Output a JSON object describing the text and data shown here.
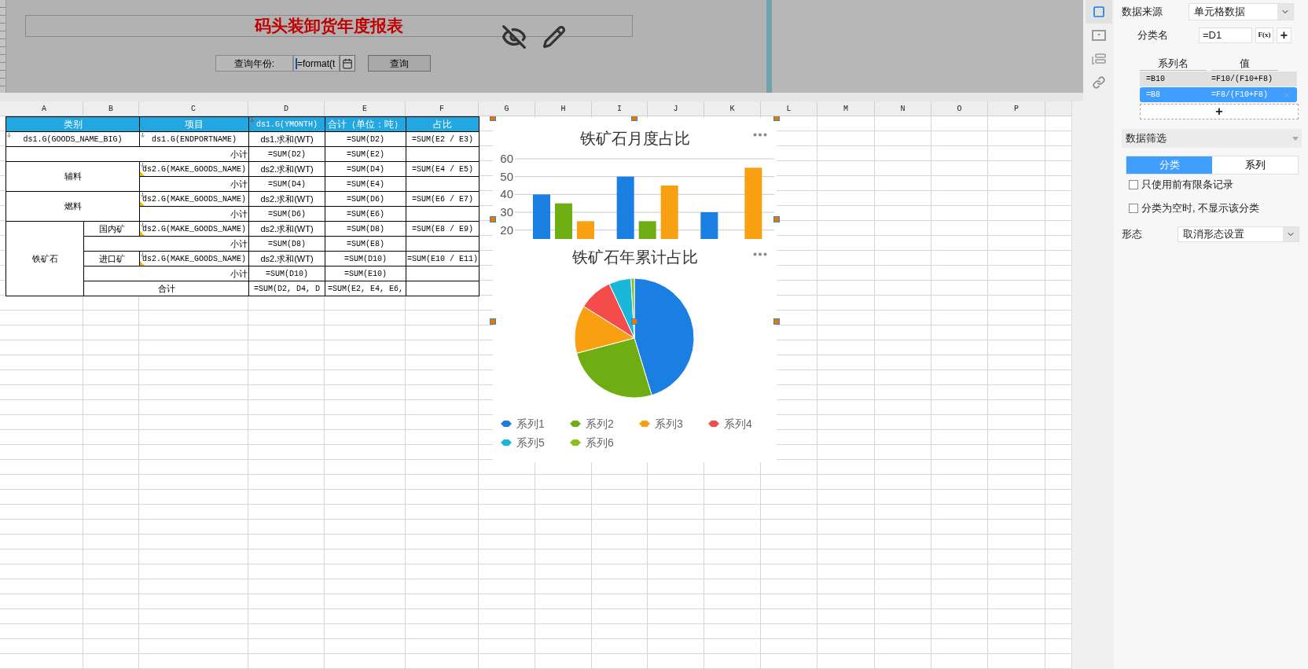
{
  "report_header": {
    "title": "码头装卸货年度报表",
    "query_label": "查询年份:",
    "query_value": "=format(t",
    "query_button": "查询"
  },
  "sheet": {
    "columns": [
      "A",
      "B",
      "C",
      "D",
      "E",
      "F",
      "G",
      "H",
      "I",
      "J",
      "K",
      "L",
      "M",
      "N",
      "O",
      "P"
    ],
    "table_rows": [
      {
        "header": true,
        "cells": [
          {
            "text": "类别",
            "colspan": 2,
            "kind": "plain",
            "expand": false,
            "filter": false
          },
          {
            "text": "项目",
            "kind": "plain",
            "expand": false,
            "filter": false
          },
          {
            "text": "ds1.G(YMONTH)",
            "kind": "plain",
            "expand": true,
            "filter": false
          },
          {
            "text": "合计（单位：吨）",
            "kind": "plain",
            "expand": false,
            "filter": false
          },
          {
            "text": "占比",
            "kind": "plain",
            "expand": false,
            "filter": false
          }
        ]
      },
      {
        "header": false,
        "cells": [
          {
            "text": "ds1.G(GOODS_NAME_BIG)",
            "colspan": 2,
            "kind": "plain",
            "expand": true,
            "filter": false
          },
          {
            "text": "ds1.G(ENDPORTNAME)",
            "kind": "plain",
            "expand": true,
            "filter": false
          },
          {
            "text": "ds1.求和(WT)",
            "kind": "plain",
            "expand": false,
            "filter": false
          },
          {
            "text": "=SUM(D2)",
            "kind": "plain",
            "expand": false,
            "filter": false
          },
          {
            "text": "=SUM(E2 / E3)",
            "kind": "plain",
            "expand": false,
            "filter": false
          }
        ]
      },
      {
        "header": false,
        "cells": [
          {
            "text": "小计",
            "colspan": 3,
            "kind": "subtotal",
            "expand": false,
            "filter": false
          },
          {
            "text": "=SUM(D2)",
            "kind": "plain",
            "expand": false,
            "filter": false
          },
          {
            "text": "=SUM(E2)",
            "kind": "plain",
            "expand": false,
            "filter": false
          }
        ]
      },
      {
        "header": false,
        "cells": [
          {
            "text": "辅料",
            "colspan": 2,
            "rowspan": 2,
            "kind": "plain",
            "expand": false,
            "filter": false
          },
          {
            "text": "ds2.G(MAKE_GOODS_NAME)",
            "kind": "plain",
            "expand": true,
            "filter": true
          },
          {
            "text": "ds2.求和(WT)",
            "kind": "plain",
            "expand": false,
            "filter": false
          },
          {
            "text": "=SUM(D4)",
            "kind": "plain",
            "expand": false,
            "filter": false
          },
          {
            "text": "=SUM(E4 / E5)",
            "kind": "plain",
            "expand": false,
            "filter": false
          }
        ]
      },
      {
        "header": false,
        "cells": [
          {
            "text": "小计",
            "kind": "subtotal",
            "expand": false,
            "filter": false
          },
          {
            "text": "=SUM(D4)",
            "kind": "plain",
            "expand": false,
            "filter": false
          },
          {
            "text": "=SUM(E4)",
            "kind": "plain",
            "expand": false,
            "filter": false
          }
        ]
      },
      {
        "header": false,
        "cells": [
          {
            "text": "燃料",
            "colspan": 2,
            "rowspan": 2,
            "kind": "plain",
            "expand": false,
            "filter": false
          },
          {
            "text": "ds2.G(MAKE_GOODS_NAME)",
            "kind": "plain",
            "expand": true,
            "filter": true
          },
          {
            "text": "ds2.求和(WT)",
            "kind": "plain",
            "expand": false,
            "filter": false
          },
          {
            "text": "=SUM(D6)",
            "kind": "plain",
            "expand": false,
            "filter": false
          },
          {
            "text": "=SUM(E6 / E7)",
            "kind": "plain",
            "expand": false,
            "filter": false
          }
        ]
      },
      {
        "header": false,
        "cells": [
          {
            "text": "小计",
            "kind": "subtotal",
            "expand": false,
            "filter": false
          },
          {
            "text": "=SUM(D6)",
            "kind": "plain",
            "expand": false,
            "filter": false
          },
          {
            "text": "=SUM(E6)",
            "kind": "plain",
            "expand": false,
            "filter": false
          }
        ]
      },
      {
        "header": false,
        "cells": [
          {
            "text": "铁矿石",
            "rowspan": 5,
            "kind": "plain",
            "expand": false,
            "filter": false
          },
          {
            "text": "国内矿",
            "kind": "plain",
            "expand": false,
            "filter": false
          },
          {
            "text": "ds2.G(MAKE_GOODS_NAME)",
            "kind": "plain",
            "expand": true,
            "filter": true
          },
          {
            "text": "ds2.求和(WT)",
            "kind": "plain",
            "expand": false,
            "filter": false
          },
          {
            "text": "=SUM(D8)",
            "kind": "plain",
            "expand": false,
            "filter": false
          },
          {
            "text": "=SUM(E8 / E9)",
            "kind": "plain",
            "expand": false,
            "filter": false
          }
        ]
      },
      {
        "header": false,
        "cells": [
          {
            "text": "小计",
            "colspan": 2,
            "kind": "subtotal",
            "expand": false,
            "filter": false
          },
          {
            "text": "=SUM(D8)",
            "kind": "plain",
            "expand": false,
            "filter": false
          },
          {
            "text": "=SUM(E8)",
            "kind": "plain",
            "expand": false,
            "filter": false
          }
        ]
      },
      {
        "header": false,
        "cells": [
          {
            "text": "进口矿",
            "kind": "plain",
            "expand": false,
            "filter": false
          },
          {
            "text": "ds2.G(MAKE_GOODS_NAME)",
            "kind": "plain",
            "expand": true,
            "filter": true
          },
          {
            "text": "ds2.求和(WT)",
            "kind": "plain",
            "expand": false,
            "filter": false
          },
          {
            "text": "=SUM(D10)",
            "kind": "plain",
            "expand": false,
            "filter": false
          },
          {
            "text": "=SUM(E10 / E11)",
            "kind": "plain",
            "expand": false,
            "filter": false
          }
        ]
      },
      {
        "header": false,
        "cells": [
          {
            "text": "小计",
            "colspan": 2,
            "kind": "subtotal",
            "expand": false,
            "filter": false
          },
          {
            "text": "=SUM(D10)",
            "kind": "plain",
            "expand": false,
            "filter": false
          },
          {
            "text": "=SUM(E10)",
            "kind": "plain",
            "expand": false,
            "filter": false
          }
        ]
      },
      {
        "header": false,
        "cells": [
          {
            "text": "合计",
            "colspan": 2,
            "kind": "plain",
            "expand": false,
            "filter": false
          },
          {
            "text": "=SUM(D2, D4, D",
            "kind": "plain",
            "expand": false,
            "filter": false
          },
          {
            "text": "=SUM(E2, E4, E6,",
            "kind": "plain",
            "expand": false,
            "filter": false
          }
        ]
      }
    ]
  },
  "charts": [
    {
      "title": "铁矿石月度占比",
      "chart_data": {
        "type": "bar",
        "grid": true,
        "ylim": [
          15,
          60
        ],
        "yticks": [
          20,
          30,
          40,
          50,
          60
        ],
        "series": [
          {
            "color": "#1a7fe0",
            "values": [
              40,
              50,
              30
            ]
          },
          {
            "color": "#6fae12",
            "values": [
              35,
              25,
              null
            ]
          },
          {
            "color": "#f8a012",
            "values": [
              25,
              45,
              55
            ]
          }
        ]
      }
    },
    {
      "title": "铁矿石年累计占比",
      "legend": [
        {
          "label": "系列1",
          "color": "#1a7fe0"
        },
        {
          "label": "系列2",
          "color": "#6fae12"
        },
        {
          "label": "系列3",
          "color": "#f8a012"
        },
        {
          "label": "系列4",
          "color": "#f44b4b"
        },
        {
          "label": "系列5",
          "color": "#1ab8d8"
        },
        {
          "label": "系列6",
          "color": "#86c21a"
        }
      ]
    }
  ],
  "panel": {
    "side_tabs": [
      {
        "kind": "frame",
        "selected": true
      },
      {
        "kind": "dropdown",
        "selected": false
      },
      {
        "kind": "layout",
        "selected": false
      },
      {
        "kind": "link",
        "selected": false
      }
    ],
    "source_label": "数据来源",
    "source_value": "单元格数据",
    "category_label": "分类名",
    "category_value": "=D1",
    "fx_label": "F(x)",
    "add_symbol": "+",
    "series_headers": [
      "系列名",
      "值"
    ],
    "series_rows": [
      {
        "name": "=B10",
        "value": "=F10/(F10+F8)",
        "selected": false
      },
      {
        "name": "=B8",
        "value": "=F8/(F10+F8)",
        "selected": true
      }
    ],
    "series_add": "+",
    "filter_title": "数据筛选",
    "filter_tabs": [
      {
        "label": "分类",
        "selected": true
      },
      {
        "label": "系列",
        "selected": false
      }
    ],
    "options": [
      {
        "label": "只使用前有限条记录",
        "checked": false
      },
      {
        "label": "分类为空时, 不显示该分类",
        "checked": false
      }
    ],
    "style_label": "形态",
    "style_value": "取消形态设置"
  }
}
